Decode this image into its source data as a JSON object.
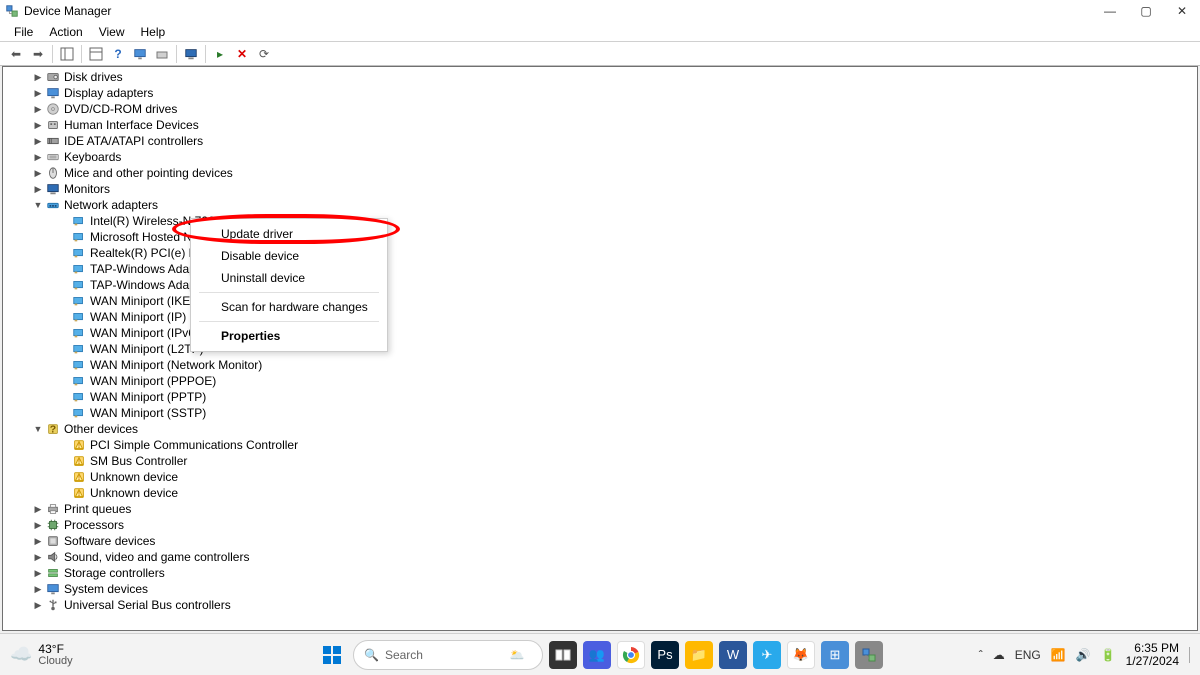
{
  "window": {
    "title": "Device Manager"
  },
  "menu": {
    "file": "File",
    "action": "Action",
    "view": "View",
    "help": "Help"
  },
  "context": {
    "update": "Update driver",
    "disable": "Disable device",
    "uninstall": "Uninstall device",
    "scan": "Scan for hardware changes",
    "properties": "Properties"
  },
  "tree": {
    "disk": "Disk drives",
    "display": "Display adapters",
    "dvd": "DVD/CD-ROM drives",
    "hid": "Human Interface Devices",
    "ide": "IDE ATA/ATAPI controllers",
    "kbd": "Keyboards",
    "mice": "Mice and other pointing devices",
    "mon": "Monitors",
    "net": "Network adapters",
    "net_items": [
      "Intel(R) Wireless-N 7260",
      "Microsoft Hosted Netw",
      "Realtek(R) PCI(e) Ethern",
      "TAP-Windows Adapter V",
      "TAP-Windows Adapter V",
      "WAN Miniport (IKEv2)",
      "WAN Miniport (IP)",
      "WAN Miniport (IPv6)",
      "WAN Miniport (L2TP)",
      "WAN Miniport (Network Monitor)",
      "WAN Miniport (PPPOE)",
      "WAN Miniport (PPTP)",
      "WAN Miniport (SSTP)"
    ],
    "other": "Other devices",
    "other_items": [
      "PCI Simple Communications Controller",
      "SM Bus Controller",
      "Unknown device",
      "Unknown device"
    ],
    "print": "Print queues",
    "proc": "Processors",
    "soft": "Software devices",
    "sound": "Sound, video and game controllers",
    "storage": "Storage controllers",
    "sysdev": "System devices",
    "usb": "Universal Serial Bus controllers"
  },
  "taskbar": {
    "temp": "43°F",
    "weather": "Cloudy",
    "search_placeholder": "Search",
    "lang": "ENG",
    "time": "6:35 PM",
    "date": "1/27/2024"
  }
}
